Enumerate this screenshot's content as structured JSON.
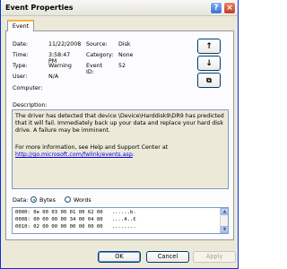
{
  "window": {
    "title": "Event Properties",
    "help_glyph": "?",
    "close_glyph": "×"
  },
  "tabs": [
    {
      "label": "Event"
    }
  ],
  "info": {
    "date_label": "Date:",
    "date": "11/22/2008",
    "source_label": "Source:",
    "source": "Disk",
    "time_label": "Time:",
    "time": "3:58:47 PM",
    "category_label": "Category:",
    "category": "None",
    "type_label": "Type:",
    "type": "Warning",
    "eventid_label": "Event ID:",
    "eventid": "52",
    "user_label": "User:",
    "user": "N/A",
    "computer_label": "Computer:",
    "computer": ""
  },
  "nav": {
    "up": "↑",
    "down": "↓",
    "copy": "⧉"
  },
  "description": {
    "label": "Description:",
    "para1": "The driver has detected that device \\Device\\Harddisk9\\DR9 has predicted that it will fail.  Immediately back up your data and replace your hard disk drive. A failure  may be imminent.",
    "para2_prefix": "For more information, see Help and Support Center at",
    "link": "http://go.microsoft.com/fwlink/events.asp",
    "para2_suffix": "."
  },
  "data": {
    "label": "Data:",
    "bytes_label": "Bytes",
    "words_label": "Words",
    "selected": "bytes",
    "lines": [
      "0000: 0e 00 03 00 01 00 62 00   ......b.",
      "0008: 00 00 00 00 34 00 04 80   ....4..€",
      "0010: 02 00 00 00 00 00 00 00   ........"
    ]
  },
  "buttons": {
    "ok": "OK",
    "cancel": "Cancel",
    "apply": "Apply"
  },
  "colors": {
    "title_border": "#0831d9",
    "link": "#0000ee",
    "tab_accent": "#f7b539"
  }
}
